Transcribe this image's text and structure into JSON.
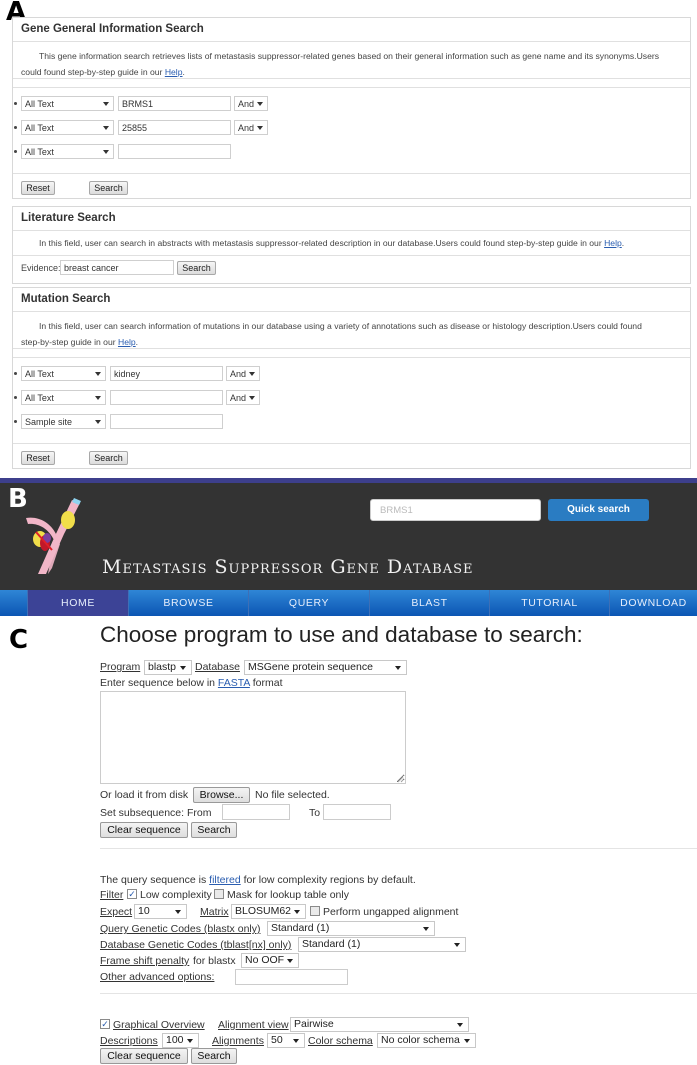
{
  "panels": {
    "a": "A",
    "b": "B",
    "c": "C"
  },
  "gene_search": {
    "title": "Gene General Information Search",
    "description_line1": "This gene information search retrieves lists of metastasis suppressor-related genes based on their general information such as gene name and its synonyms.Users",
    "description_line2": "could found step-by-step guide in our ",
    "help_link": "Help",
    "period": ".",
    "rows": [
      {
        "field": "All Text",
        "value": "BRMS1",
        "operator": "And"
      },
      {
        "field": "All Text",
        "value": "25855",
        "operator": "And"
      },
      {
        "field": "All Text",
        "value": ""
      }
    ],
    "reset_label": "Reset",
    "search_label": "Search"
  },
  "literature_search": {
    "title": "Literature Search",
    "description": "In this field, user can search in abstracts with metastasis suppressor-related description in our database.Users could found step-by-step guide in our ",
    "help_link": "Help",
    "period": ".",
    "evidence_label": "Evidence:",
    "evidence_value": "breast cancer",
    "search_label": "Search"
  },
  "mutation_search": {
    "title": "Mutation Search",
    "description_line1": "In this field, user can search information of mutations in our database using a variety of annotations such as disease or histology description.Users could found",
    "description_line2": "step-by-step guide in our ",
    "help_link": "Help",
    "period": ".",
    "rows": [
      {
        "field": "All Text",
        "value": "kidney",
        "operator": "And"
      },
      {
        "field": "All Text",
        "value": "",
        "operator": "And"
      },
      {
        "field": "Sample site",
        "value": ""
      }
    ],
    "reset_label": "Reset",
    "search_label": "Search"
  },
  "site_header": {
    "title": "Metastasis Suppressor Gene Database",
    "logo_icon": "metastasis-vessel-logo",
    "quick_search_placeholder": "BRMS1",
    "quick_search_button": "Quick search",
    "nav": [
      {
        "label": "HOME",
        "active": true
      },
      {
        "label": "BROWSE"
      },
      {
        "label": "QUERY"
      },
      {
        "label": "BLAST"
      },
      {
        "label": "TUTORIAL"
      },
      {
        "label": "DOWNLOAD"
      }
    ],
    "colors": {
      "header_bg": "#333333",
      "nav_blue": "#1a6cc4",
      "nav_active": "#3c4396",
      "button_blue": "#2a7cc2"
    }
  },
  "blast": {
    "title": "Choose program to use and database to search:",
    "program_label": "Program",
    "program_value": "blastp",
    "database_label": "Database",
    "database_value": "MSGene protein sequence",
    "enter_prefix": "Enter sequence below in ",
    "fasta_link": "FASTA",
    "enter_suffix": " format",
    "sequence_value": "",
    "load_label": "Or load it from disk",
    "browse_label": "Browse...",
    "no_file": "No file selected.",
    "subseq_label": "Set subsequence: From",
    "to_label": "To",
    "from_value": "",
    "to_value": "",
    "clear_label": "Clear sequence",
    "search_label": "Search",
    "filtered_prefix": "The query sequence is ",
    "filtered_link": "filtered",
    "filtered_suffix": " for low complexity regions by default.",
    "filter_label": "Filter",
    "low_complexity_label": "Low complexity",
    "low_complexity_checked": true,
    "mask_label": "Mask for lookup table only",
    "mask_checked": false,
    "expect_label": "Expect",
    "expect_value": "10",
    "matrix_label": "Matrix",
    "matrix_value": "BLOSUM62",
    "ungapped_label": "Perform ungapped alignment",
    "ungapped_checked": false,
    "query_codes_label": "Query Genetic Codes (blastx only)",
    "query_codes_value": "Standard (1)",
    "db_codes_label": "Database Genetic Codes (tblast[nx] only)",
    "db_codes_value": "Standard (1)",
    "frame_shift_label": "Frame shift penalty",
    "frame_shift_suffix": "for blastx",
    "frame_shift_value": "No OOF",
    "advanced_label": "Other advanced options:",
    "advanced_value": "",
    "graphical_overview_label": "Graphical Overview",
    "graphical_overview_checked": true,
    "alignment_view_label": "Alignment view",
    "alignment_view_value": "Pairwise",
    "descriptions_label": "Descriptions",
    "descriptions_value": "100",
    "alignments_label": "Alignments",
    "alignments_value": "50",
    "color_schema_label": "Color schema",
    "color_schema_value": "No color schema",
    "clear_label_2": "Clear sequence",
    "search_label_2": "Search"
  }
}
